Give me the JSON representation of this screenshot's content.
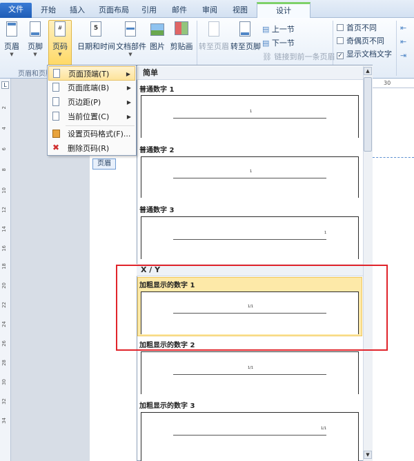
{
  "tabs": {
    "file": "文件",
    "home": "开始",
    "insert": "插入",
    "layout": "页面布局",
    "references": "引用",
    "mailings": "邮件",
    "review": "审阅",
    "view": "视图",
    "design": "设计"
  },
  "ribbon": {
    "header": "页眉",
    "footer": "页脚",
    "page_number": "页码",
    "datetime": "日期和时间",
    "docparts": "文档部件",
    "picture": "图片",
    "clipart": "剪贴画",
    "goto_header": "转至页眉",
    "goto_footer": "转至页脚",
    "prev_section": "上一节",
    "next_section": "下一节",
    "link_prev": "链接到前一条页眉",
    "group_label": "页眉和页脚",
    "options": {
      "diff_first": {
        "label": "首页不同",
        "checked": false
      },
      "diff_oddeven": {
        "label": "奇偶页不同",
        "checked": false
      },
      "show_text": {
        "label": "显示文档文字",
        "checked": true
      }
    }
  },
  "menu": {
    "items": [
      {
        "label": "页面顶端(T)",
        "has_sub": true
      },
      {
        "label": "页面底端(B)",
        "has_sub": true
      },
      {
        "label": "页边距(P)",
        "has_sub": true
      },
      {
        "label": "当前位置(C)",
        "has_sub": true
      },
      {
        "label": "设置页码格式(F)...",
        "has_sub": false
      },
      {
        "label": "删除页码(R)",
        "has_sub": false
      }
    ]
  },
  "gallery": {
    "section_simple": "简单",
    "section_xy": "X / Y",
    "items": [
      {
        "title": "普通数字 1",
        "sample": "1"
      },
      {
        "title": "普通数字 2",
        "sample": "1"
      },
      {
        "title": "普通数字 3",
        "sample": "1"
      },
      {
        "title": "加粗显示的数字 1",
        "sample": "1/1"
      },
      {
        "title": "加粗显示的数字 2",
        "sample": "1/1"
      },
      {
        "title": "加粗显示的数字 3",
        "sample": "1/1"
      }
    ]
  },
  "document": {
    "header_tag": "页眉",
    "ruler_marks": [
      "28",
      "30"
    ],
    "vruler_marks": [
      "2",
      "4",
      "6",
      "8",
      "10",
      "12",
      "14",
      "16",
      "18",
      "20",
      "22",
      "24",
      "26",
      "28",
      "30",
      "32",
      "34"
    ]
  },
  "colors": {
    "accent_file_tab": "#1f5db6",
    "highlight": "#fde9a8",
    "annotation_box": "#e0232a"
  }
}
